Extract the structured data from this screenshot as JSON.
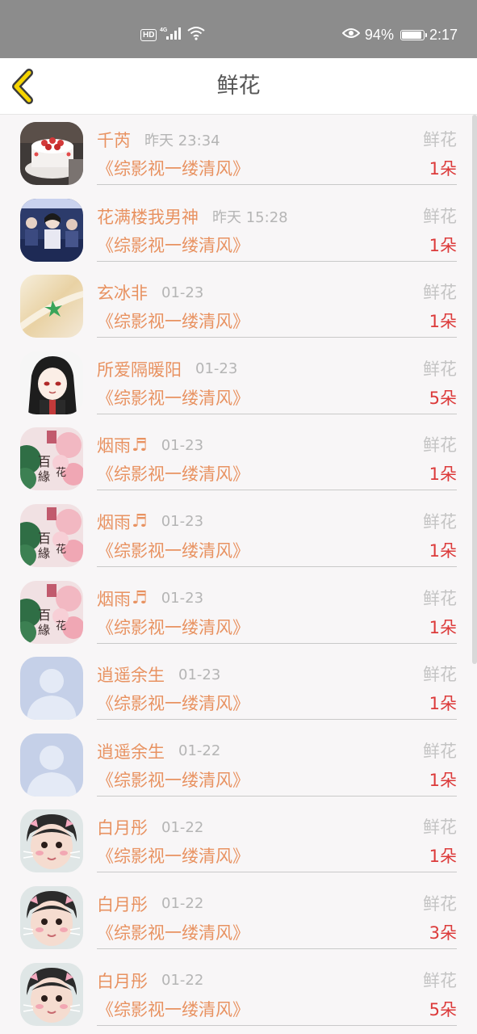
{
  "status_bar": {
    "hd_badge": "HD",
    "network": "4G",
    "battery_percent": "94%",
    "battery_level": 0.94,
    "time": "2:17",
    "icons": [
      "signal-icon",
      "wifi-icon",
      "eye-icon",
      "battery-icon"
    ]
  },
  "header": {
    "title": "鲜花",
    "back_icon": "chevron-left-icon"
  },
  "colors": {
    "accent": "#e89261",
    "count": "#dc3a3a",
    "muted": "#b5b5b5",
    "back_icon_fill": "#f5d400"
  },
  "gifts": [
    {
      "user": "千芮",
      "time": "昨天 23:34",
      "work": "《综影视一缕清风》",
      "gift": "鲜花",
      "count": "1朵",
      "avatar": "cake",
      "music_icon": false
    },
    {
      "user": "花满楼我男神",
      "time": "昨天 15:28",
      "work": "《综影视一缕清风》",
      "gift": "鲜花",
      "count": "1朵",
      "avatar": "photo",
      "music_icon": false
    },
    {
      "user": "玄冰非",
      "time": "01-23",
      "work": "《综影视一缕清风》",
      "gift": "鲜花",
      "count": "1朵",
      "avatar": "leaf",
      "music_icon": false
    },
    {
      "user": "所爱隔暖阳",
      "time": "01-23",
      "work": "《综影视一缕清风》",
      "gift": "鲜花",
      "count": "5朵",
      "avatar": "anime",
      "music_icon": false
    },
    {
      "user": "烟雨",
      "time": "01-23",
      "work": "《综影视一缕清风》",
      "gift": "鲜花",
      "count": "1朵",
      "avatar": "floral",
      "music_icon": true
    },
    {
      "user": "烟雨",
      "time": "01-23",
      "work": "《综影视一缕清风》",
      "gift": "鲜花",
      "count": "1朵",
      "avatar": "floral",
      "music_icon": true
    },
    {
      "user": "烟雨",
      "time": "01-23",
      "work": "《综影视一缕清风》",
      "gift": "鲜花",
      "count": "1朵",
      "avatar": "floral",
      "music_icon": true
    },
    {
      "user": "逍遥余生",
      "time": "01-23",
      "work": "《综影视一缕清风》",
      "gift": "鲜花",
      "count": "1朵",
      "avatar": "default",
      "music_icon": false
    },
    {
      "user": "逍遥余生",
      "time": "01-22",
      "work": "《综影视一缕清风》",
      "gift": "鲜花",
      "count": "1朵",
      "avatar": "default",
      "music_icon": false
    },
    {
      "user": "白月彤",
      "time": "01-22",
      "work": "《综影视一缕清风》",
      "gift": "鲜花",
      "count": "1朵",
      "avatar": "baby",
      "music_icon": false
    },
    {
      "user": "白月彤",
      "time": "01-22",
      "work": "《综影视一缕清风》",
      "gift": "鲜花",
      "count": "3朵",
      "avatar": "baby",
      "music_icon": false
    },
    {
      "user": "白月彤",
      "time": "01-22",
      "work": "《综影视一缕清风》",
      "gift": "鲜花",
      "count": "5朵",
      "avatar": "baby",
      "music_icon": false
    }
  ]
}
